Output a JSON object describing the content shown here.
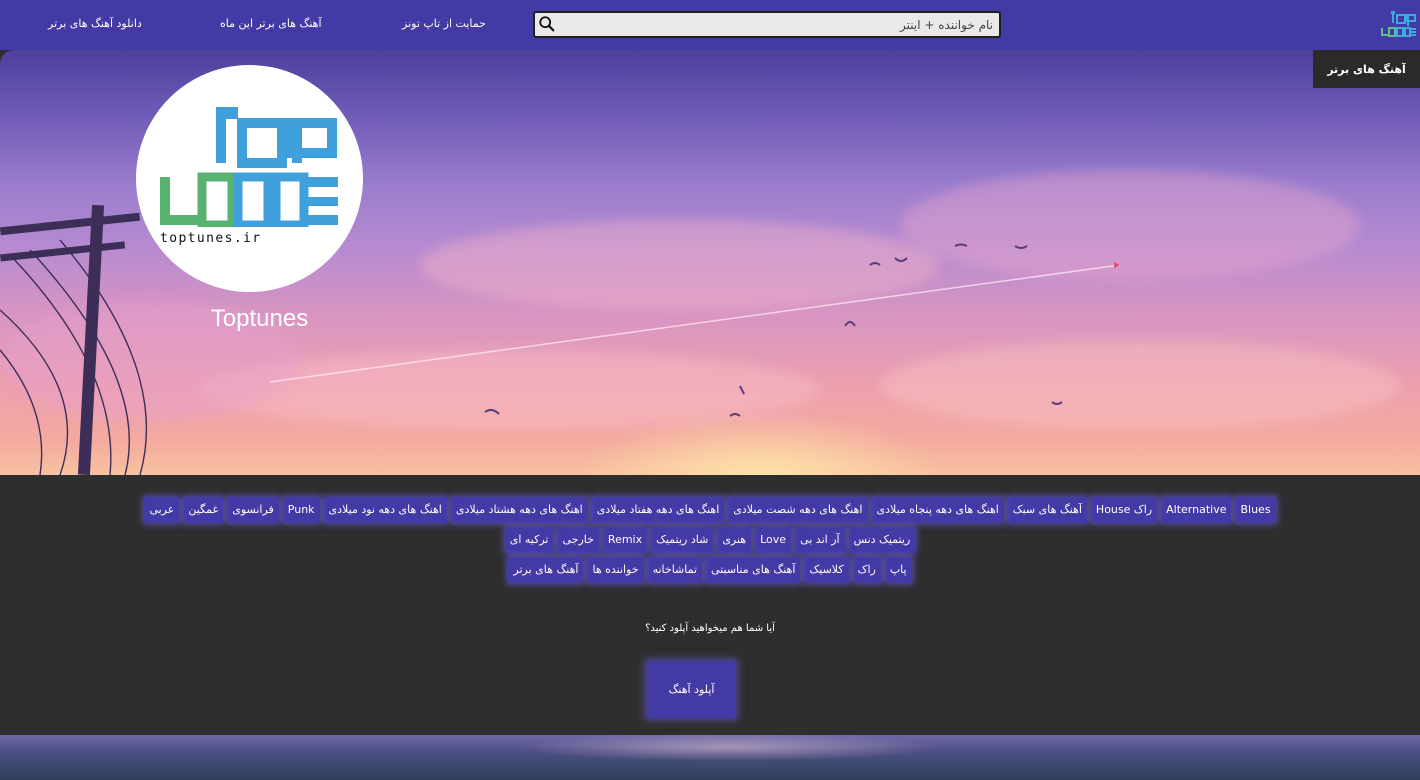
{
  "colors": {
    "primary": "#433aa6",
    "dark": "#2e2e2e",
    "tab_bg": "#2a2a2a",
    "white": "#ffffff"
  },
  "nav": {
    "links": [
      "دانلود آهنگ های برتر",
      "آهنگ های برتر این ماه",
      "حمایت از تاپ تونز "
    ],
    "search_placeholder": "نام خواننده + اینتر",
    "brand": "top tunes"
  },
  "hero": {
    "tab_label": "آهنگ های برتر",
    "channel_name": "Toptunes",
    "avatar_domain": "toptunes.ir",
    "avatar_logo_text": [
      "top",
      "tunes"
    ]
  },
  "genres": {
    "rows": [
      [
        "Blues",
        "Alternative",
        "راک House",
        "آهنگ های سبک",
        "اهنگ های دهه پنجاه میلادی",
        "اهنگ های دهه شصت میلادی",
        "اهنگ های دهه هفتاد میلادی",
        "اهنگ های دهه هشتاد میلادی",
        "اهنگ های دهه نود میلادی",
        "Punk",
        "فرانسوی",
        "غمگین",
        "عربی"
      ],
      [
        "ریتمیک دنس",
        "آر اند بی",
        "Love",
        "هنری",
        "شاد ریتمیک",
        "Remix",
        "خارجی",
        "ترکیه ای"
      ],
      [
        "پاپ",
        "راک",
        "کلاسیک",
        "آهنگ های مناسبتی",
        "تماشاخانه",
        "خواننده ها",
        "آهنگ های برتر"
      ]
    ]
  },
  "upload": {
    "question": "آیا شما هم میخواهید آپلود کنید؟",
    "button": "آپلود آهنگ"
  }
}
